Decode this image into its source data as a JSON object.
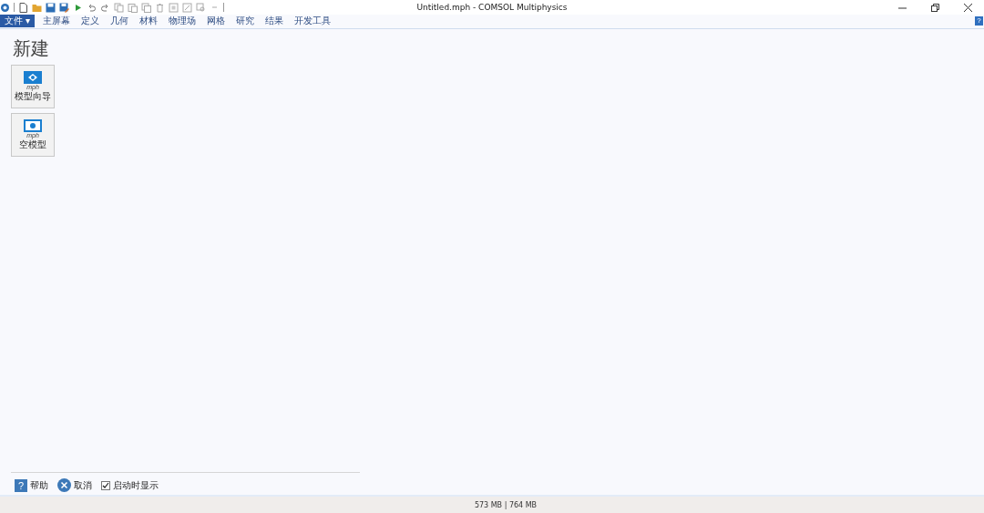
{
  "window": {
    "title": "Untitled.mph - COMSOL Multiphysics"
  },
  "file_menu": {
    "label": "文件 ▾"
  },
  "ribbon_tabs": [
    {
      "label": "主屏幕",
      "selected": false
    },
    {
      "label": "定义",
      "selected": false
    },
    {
      "label": "几何",
      "selected": false
    },
    {
      "label": "材料",
      "selected": false
    },
    {
      "label": "物理场",
      "selected": false
    },
    {
      "label": "网格",
      "selected": false
    },
    {
      "label": "研究",
      "selected": false
    },
    {
      "label": "结果",
      "selected": false
    },
    {
      "label": "开发工具",
      "selected": false
    }
  ],
  "ribbon_help": "?",
  "page": {
    "heading": "新建",
    "cards": [
      {
        "kind": "wizard",
        "caption": "mph",
        "label": "模型向导"
      },
      {
        "kind": "blank",
        "caption": "mph",
        "label": "空模型"
      }
    ],
    "footer": {
      "help": "帮助",
      "cancel": "取消",
      "show_on_startup": {
        "label": "启动时显示",
        "checked": true
      }
    }
  },
  "status_bar": {
    "memory": "573 MB | 764 MB"
  }
}
